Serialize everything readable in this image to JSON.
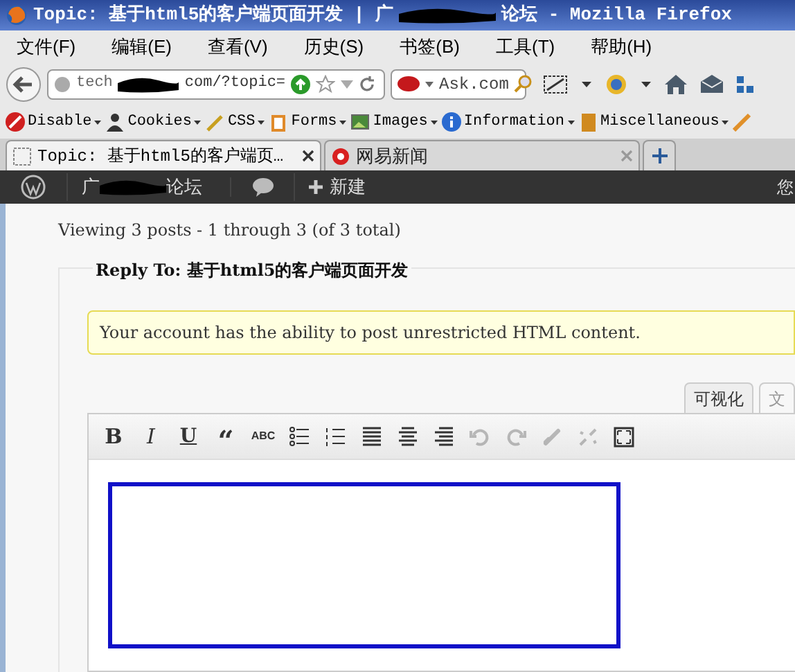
{
  "window": {
    "title_start": "Topic: 基于html5的客户端页面开发 | 广",
    "title_end": "论坛 - Mozilla Firefox"
  },
  "menu": [
    "文件(F)",
    "编辑(E)",
    "查看(V)",
    "历史(S)",
    "书签(B)",
    "工具(T)",
    "帮助(H)"
  ],
  "address_bar": {
    "url_start": "tech",
    "url_end": "com/?topic="
  },
  "search": {
    "value": "Ask.com"
  },
  "web_developer_toolbar": [
    "Disable",
    "Cookies",
    "CSS",
    "Forms",
    "Images",
    "Information",
    "Miscellaneous"
  ],
  "tabs": [
    {
      "label": "Topic: 基于html5的客户端页…",
      "selected": true
    },
    {
      "label": "网易新闻",
      "selected": false
    }
  ],
  "admin_bar": {
    "site_start": "广",
    "site_end": "论坛",
    "new_label": "新建",
    "right_cut": "您"
  },
  "page": {
    "viewing": "Viewing 3 posts - 1 through 3 (of 3 total)",
    "reply_title": "Reply To: 基于html5的客户端页面开发",
    "notice": "Your account has the ability to post unrestricted HTML content."
  },
  "editor": {
    "tabs": [
      {
        "label": "可视化",
        "selected": true
      },
      {
        "label": "文",
        "selected": false
      }
    ],
    "tools": [
      {
        "kind": "bold",
        "label": "B",
        "disabled": false
      },
      {
        "kind": "italic",
        "label": "I",
        "disabled": false
      },
      {
        "kind": "underline",
        "label": "U",
        "disabled": false
      },
      {
        "kind": "quote",
        "label": "“",
        "disabled": false
      },
      {
        "kind": "strike",
        "label": "ABC",
        "disabled": false
      },
      {
        "kind": "bullets",
        "disabled": false
      },
      {
        "kind": "numbers",
        "disabled": false
      },
      {
        "kind": "align-left",
        "disabled": false
      },
      {
        "kind": "align-center",
        "disabled": false
      },
      {
        "kind": "align-right",
        "disabled": false
      },
      {
        "kind": "undo",
        "disabled": true
      },
      {
        "kind": "redo",
        "disabled": true
      },
      {
        "kind": "link",
        "disabled": true
      },
      {
        "kind": "unlink",
        "disabled": true
      },
      {
        "kind": "fullscreen",
        "disabled": false
      }
    ]
  }
}
